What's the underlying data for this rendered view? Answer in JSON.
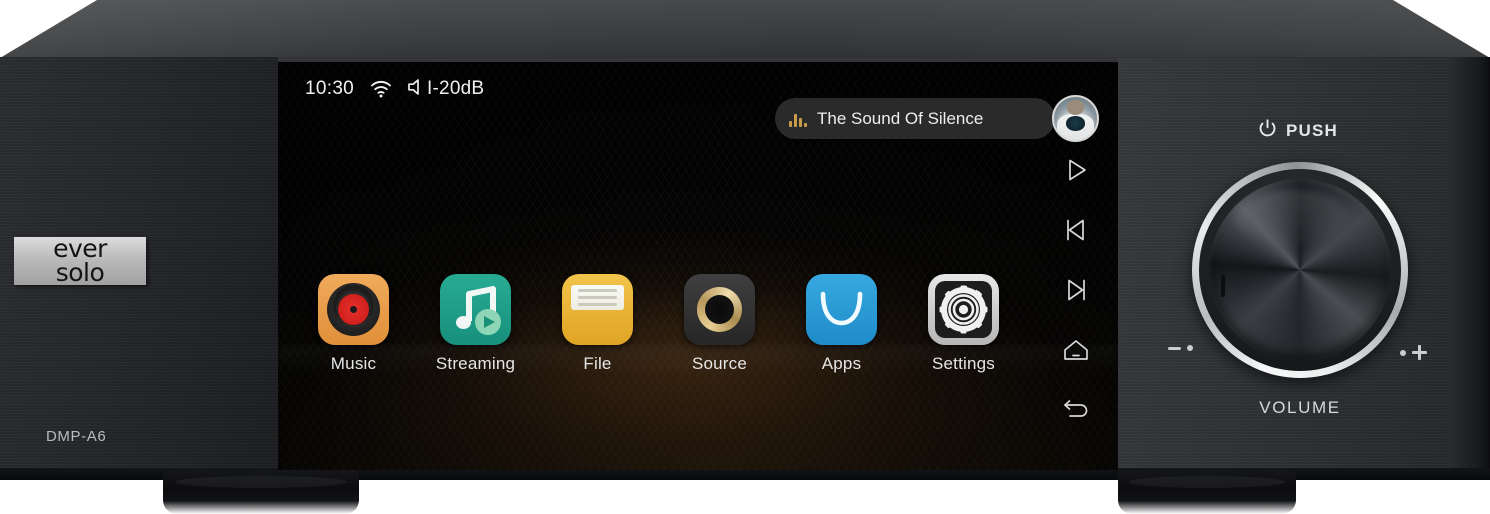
{
  "device": {
    "brand_line1": "ever",
    "brand_line2": "solo",
    "model": "DMP-A6"
  },
  "screen": {
    "statusbar": {
      "clock": "10:30",
      "wifi_icon": "wifi-icon",
      "volume_icon": "speaker-icon",
      "volume_db": "I-20dB"
    },
    "now_playing": {
      "eq_icon": "equalizer-bars-icon",
      "title": "The Sound Of Silence",
      "album_art": "album-art-avatar",
      "accent": "#c79b4a"
    },
    "apps": [
      {
        "label": "Music",
        "icon": "vinyl-record-icon",
        "color": "#e08f39"
      },
      {
        "label": "Streaming",
        "icon": "music-note-play-icon",
        "color": "#17907c"
      },
      {
        "label": "File",
        "icon": "file-folder-icon",
        "color": "#e0a424"
      },
      {
        "label": "Source",
        "icon": "audio-jack-icon",
        "color": "#262626"
      },
      {
        "label": "Apps",
        "icon": "shopping-bag-icon",
        "color": "#1e8cc9"
      },
      {
        "label": "Settings",
        "icon": "gear-icon",
        "color": "#b6b6b6"
      }
    ],
    "sidenav": [
      {
        "icon": "play-icon",
        "name": "play"
      },
      {
        "icon": "previous-icon",
        "name": "previous-track"
      },
      {
        "icon": "next-icon",
        "name": "next-track"
      },
      {
        "icon": "home-icon",
        "name": "home"
      },
      {
        "icon": "back-icon",
        "name": "back"
      }
    ]
  },
  "controls": {
    "power_icon": "power-icon",
    "push_label": "PUSH",
    "volume_label": "VOLUME",
    "minus_mark": "minus-indicator",
    "plus_mark": "plus-indicator"
  }
}
